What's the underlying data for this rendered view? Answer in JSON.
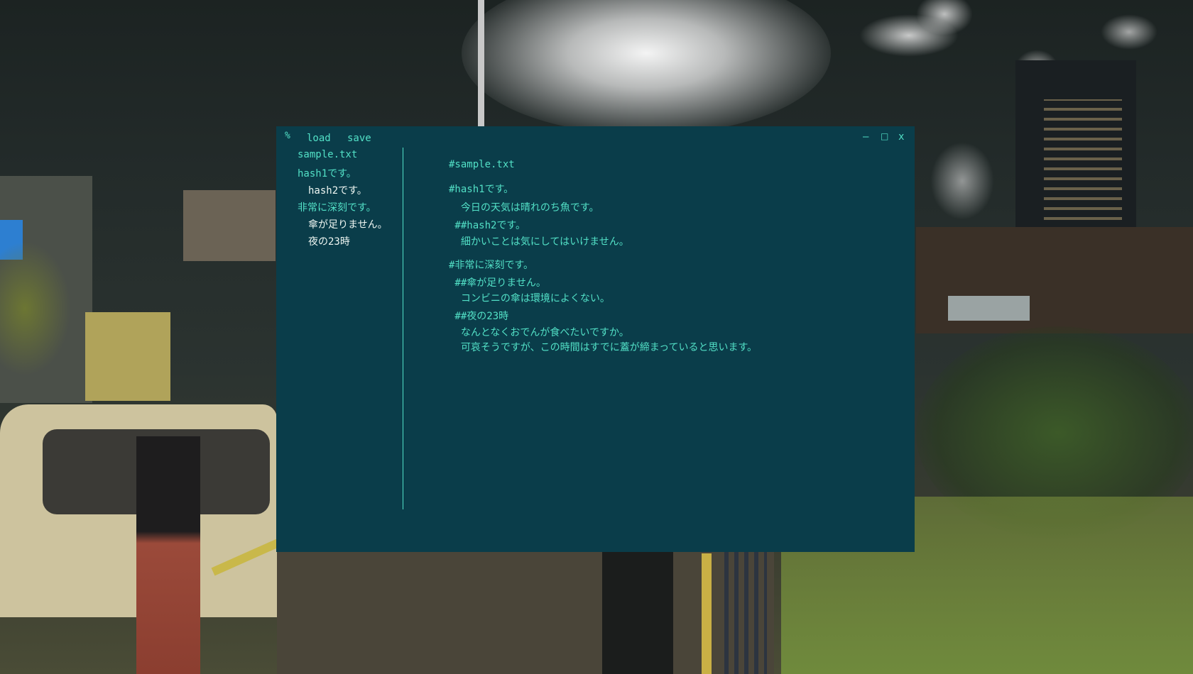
{
  "menu": {
    "prompt_icon": "%",
    "load_label": "load",
    "save_label": "save",
    "minimize_label": "–",
    "maximize_label": "□",
    "close_label": "x"
  },
  "sidebar": {
    "items": [
      {
        "label": "sample.txt",
        "level": 1
      },
      {
        "label": "hash1です。",
        "level": 1
      },
      {
        "label": "hash2です。",
        "level": 2
      },
      {
        "label": "非常に深刻です。",
        "level": 1
      },
      {
        "label": "傘が足りません。",
        "level": 2
      },
      {
        "label": "夜の23時",
        "level": 2
      }
    ]
  },
  "editor": {
    "lines": [
      "#sample.txt",
      "#hash1です。",
      "  今日の天気は晴れのち魚です。",
      " ##hash2です。",
      "  細かいことは気にしてはいけません。",
      "#非常に深刻です。",
      " ##傘が足りません。",
      "  コンビニの傘は環境によくない。",
      " ##夜の23時",
      "  なんとなくおでんが食べたいですか。",
      "  可哀そうですが、この時間はすでに蓋が締まっていると思います。"
    ]
  },
  "colors": {
    "window_bg": "#0a3d4a",
    "accent": "#52e0c6",
    "subheading_text": "#eef6f2"
  }
}
